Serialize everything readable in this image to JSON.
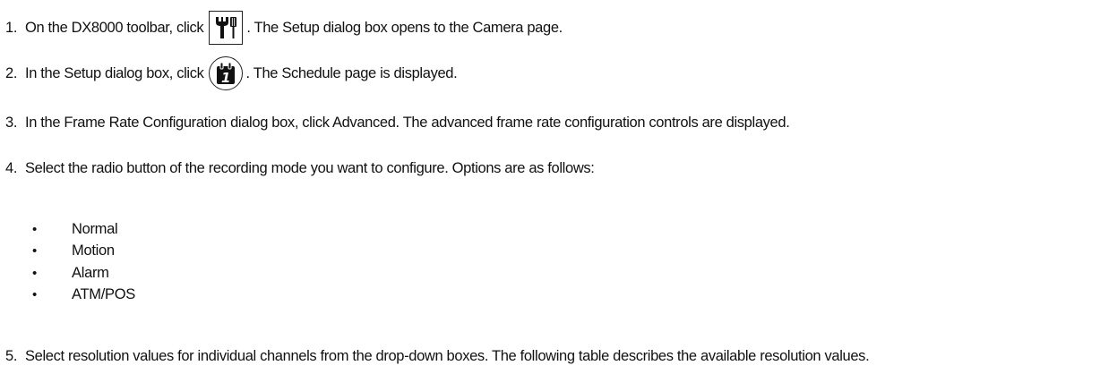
{
  "steps": [
    {
      "number": "1.",
      "before": "On the DX8000 toolbar, click",
      "icon": "setup-tools-icon",
      "after": ". The Setup dialog box opens to the Camera page."
    },
    {
      "number": "2.",
      "before": "In the Setup dialog box, click",
      "icon": "schedule-calendar-icon",
      "after": ". The Schedule page is displayed."
    },
    {
      "number": "3.",
      "text": "In the Frame Rate Configuration dialog box, click Advanced. The advanced frame rate configuration controls are displayed."
    },
    {
      "number": "4.",
      "text": "Select the radio button of the recording mode you want to configure. Options are as follows:"
    },
    {
      "number": "5.",
      "text": "Select resolution values for individual channels from the drop-down boxes. The following table describes the available resolution values."
    }
  ],
  "options": {
    "bullet": "•",
    "items": [
      "Normal",
      "Motion",
      "Alarm",
      "ATM/POS"
    ]
  },
  "icon_glyph": "1"
}
